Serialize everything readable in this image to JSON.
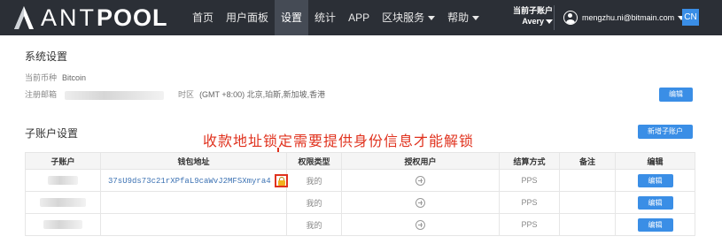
{
  "nav": {
    "logo_text_1": "ANT",
    "logo_text_2": "POOL",
    "menu": [
      {
        "label": "首页"
      },
      {
        "label": "用户面板"
      },
      {
        "label": "设置"
      },
      {
        "label": "统计"
      },
      {
        "label": "APP"
      },
      {
        "label": "区块服务"
      },
      {
        "label": "帮助"
      }
    ],
    "subaccount_label": "当前子账户",
    "subaccount_value": "Avery",
    "user_email": "mengzhu.ni@bitmain.com",
    "lang": "CN"
  },
  "system": {
    "title": "系统设置",
    "currency_label": "当前币种",
    "currency_value": "Bitcoin",
    "email_label": "注册邮箱",
    "timezone_label": "时区",
    "timezone_value": "(GMT +8:00) 北京,珀斯,新加坡,香港",
    "edit_button": "编辑"
  },
  "subaccounts": {
    "title": "子账户设置",
    "new_button": "新增子账户",
    "annotation": "收款地址锁定需要提供身份信息才能解锁",
    "headers": [
      "子账户",
      "钱包地址",
      "权限类型",
      "授权用户",
      "结算方式",
      "备注",
      "编辑"
    ],
    "rows": [
      {
        "address": "37sU9ds73c21rXPfaL9caWvJ2MFSXmyra4",
        "perm": "我的",
        "settle": "PPS",
        "note": "",
        "edit": "编辑"
      },
      {
        "address": "",
        "perm": "我的",
        "settle": "PPS",
        "note": "",
        "edit": "编辑"
      },
      {
        "address": "",
        "perm": "我的",
        "settle": "PPS",
        "note": "",
        "edit": "编辑"
      }
    ]
  },
  "colors": {
    "nav_bg": "#2b2f36",
    "accent": "#3a8ee6",
    "annotation": "#e0321e"
  }
}
